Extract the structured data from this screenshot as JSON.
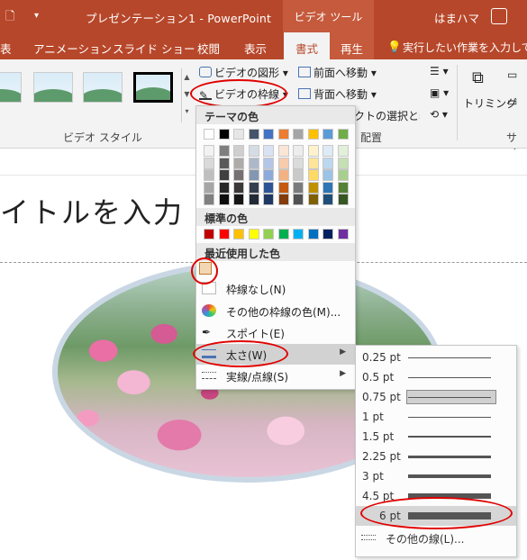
{
  "titlebar": {
    "doc_title": "プレゼンテーション1  -  PowerPoint",
    "context_tab_header": "ビデオ ツール",
    "user_name": "はまハマ"
  },
  "tabs": {
    "review_partial": "表",
    "animations": "アニメーション",
    "slideshow": "スライド ショー",
    "review": "校閲",
    "view": "表示",
    "format": "書式",
    "playback": "再生",
    "tell_me": "実行したい作業を入力してくだ"
  },
  "ribbon": {
    "video_shape": "ビデオの図形",
    "video_border": "ビデオの枠線",
    "bring_forward": "前面へ移動",
    "send_backward": "背面へ移動",
    "selection_pane": "オブジェクトの選択と表示",
    "trimming": "トリミング",
    "group_video_style": "ビデオ スタイル",
    "group_arrange": "配置",
    "group_size": "サイズ"
  },
  "slide": {
    "title_text": "イトルを入力"
  },
  "color_menu": {
    "theme_colors_heading": "テーマの色",
    "standard_colors_heading": "標準の色",
    "recent_colors_heading": "最近使用した色",
    "no_outline": "枠線なし(N)",
    "more_colors": "その他の枠線の色(M)...",
    "eyedropper": "スポイト(E)",
    "weight": "太さ(W)",
    "dashes": "実線/点線(S)",
    "theme_top_row": [
      "#ffffff",
      "#000000",
      "#e7e6e6",
      "#44546a",
      "#4472c4",
      "#ed7d31",
      "#a5a5a5",
      "#ffc000",
      "#5b9bd5",
      "#70ad47"
    ],
    "theme_shade_columns": [
      [
        "#f2f2f2",
        "#d9d9d9",
        "#bfbfbf",
        "#a6a6a6",
        "#808080"
      ],
      [
        "#7f7f7f",
        "#595959",
        "#404040",
        "#262626",
        "#0d0d0d"
      ],
      [
        "#d0cece",
        "#aeabab",
        "#757171",
        "#3a3838",
        "#171616"
      ],
      [
        "#d6dce4",
        "#adb9ca",
        "#8497b0",
        "#333f4f",
        "#222a35"
      ],
      [
        "#d9e2f3",
        "#b4c6e7",
        "#8eaadb",
        "#2f5496",
        "#1f3864"
      ],
      [
        "#fbe5d5",
        "#f7cbac",
        "#f4b183",
        "#c55a11",
        "#833c0b"
      ],
      [
        "#ededed",
        "#dbdbdb",
        "#c9c9c9",
        "#7b7b7b",
        "#525252"
      ],
      [
        "#fff2cc",
        "#fee599",
        "#ffd965",
        "#bf9000",
        "#7f6000"
      ],
      [
        "#deebf6",
        "#bdd7ee",
        "#9cc3e5",
        "#2e75b5",
        "#1f4e79"
      ],
      [
        "#e2efd9",
        "#c5e0b3",
        "#a8d08d",
        "#538135",
        "#375623"
      ]
    ],
    "standard_colors": [
      "#c00000",
      "#ff0000",
      "#ffc000",
      "#ffff00",
      "#92d050",
      "#00b050",
      "#00b0f0",
      "#0070c0",
      "#002060",
      "#7030a0"
    ],
    "recent_color": "#f3d7b5"
  },
  "weight_menu": {
    "options": [
      {
        "label": "0.25 pt",
        "pt": 0.25
      },
      {
        "label": "0.5 pt",
        "pt": 0.5
      },
      {
        "label": "0.75 pt",
        "pt": 0.75
      },
      {
        "label": "1 pt",
        "pt": 1
      },
      {
        "label": "1.5 pt",
        "pt": 1.5
      },
      {
        "label": "2.25 pt",
        "pt": 2.25
      },
      {
        "label": "3 pt",
        "pt": 3
      },
      {
        "label": "4.5 pt",
        "pt": 4.5
      },
      {
        "label": "6 pt",
        "pt": 6
      }
    ],
    "selected": "0.75 pt",
    "hovered": "6 pt",
    "more_lines": "その他の線(L)..."
  },
  "colors": {
    "accent": "#b7472a",
    "annotation_red": "#e00000"
  }
}
